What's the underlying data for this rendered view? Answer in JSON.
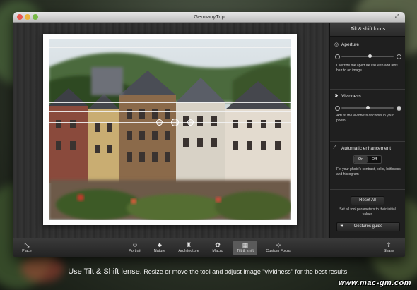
{
  "window": {
    "title": "GermanyTrip"
  },
  "panel": {
    "header": "Tilt & shift focus",
    "aperture": {
      "title": "Aperture",
      "desc": "Override the aperture value to add lens blur to an image",
      "value": 0.55
    },
    "vividness": {
      "title": "Vividness",
      "desc": "Adjust the vividness of colors in your photo",
      "value": 0.5
    },
    "auto": {
      "title": "Automatic enhancement",
      "on_label": "On",
      "off_label": "Off",
      "desc": "Fix your photo's contrast, color, brithness and histogram"
    },
    "reset": {
      "label": "Reset All",
      "desc": "Set all tool parameters to their initial values"
    },
    "gestures": {
      "label": "Gestures guide"
    }
  },
  "toolbar": {
    "place": "Place",
    "tools": [
      {
        "label": "Portrait",
        "icon": "portrait-icon"
      },
      {
        "label": "Nature",
        "icon": "tree-icon"
      },
      {
        "label": "Architecture",
        "icon": "statue-icon"
      },
      {
        "label": "Macro",
        "icon": "flower-icon"
      },
      {
        "label": "Tilt & shift",
        "icon": "tilt-shift-icon",
        "active": true
      },
      {
        "label": "Custom Focus",
        "icon": "custom-focus-icon"
      }
    ],
    "share": "Share"
  },
  "caption": {
    "lead": "Use Tilt & Shift lense.",
    "rest": "Resize or move the tool and adjust image \"vividness\" for the best results."
  },
  "watermark": "www.mac-gm.com"
}
